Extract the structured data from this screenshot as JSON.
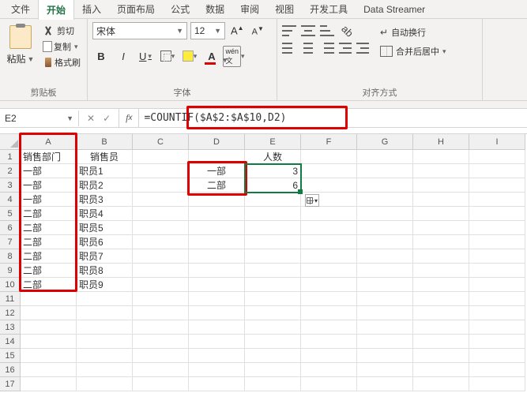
{
  "menu": {
    "tabs": [
      "文件",
      "开始",
      "插入",
      "页面布局",
      "公式",
      "数据",
      "审阅",
      "视图",
      "开发工具",
      "Data Streamer"
    ],
    "active_index": 1
  },
  "ribbon": {
    "clipboard": {
      "paste": "粘贴",
      "cut": "剪切",
      "copy": "复制",
      "format_painter": "格式刷",
      "group_label": "剪贴板"
    },
    "font": {
      "font_name": "宋体",
      "font_size": "12",
      "group_label": "字体"
    },
    "align": {
      "wrap": "自动换行",
      "merge": "合并后居中",
      "group_label": "对齐方式"
    }
  },
  "formula_bar": {
    "name_box": "E2",
    "formula": "=COUNTIF($A$2:$A$10,D2)"
  },
  "columns": [
    "A",
    "B",
    "C",
    "D",
    "E",
    "F",
    "G",
    "H",
    "I"
  ],
  "row_count": 17,
  "sheet": {
    "headers": {
      "a1": "销售部门",
      "b1": "销售员",
      "e1": "人数"
    },
    "colA": [
      "一部",
      "一部",
      "一部",
      "二部",
      "二部",
      "二部",
      "二部",
      "二部",
      "二部"
    ],
    "colB": [
      "职员1",
      "职员2",
      "职员3",
      "职员4",
      "职员5",
      "职员6",
      "职员7",
      "职员8",
      "职员9"
    ],
    "colD": [
      "一部",
      "二部"
    ],
    "colE": [
      "3",
      "6"
    ]
  }
}
